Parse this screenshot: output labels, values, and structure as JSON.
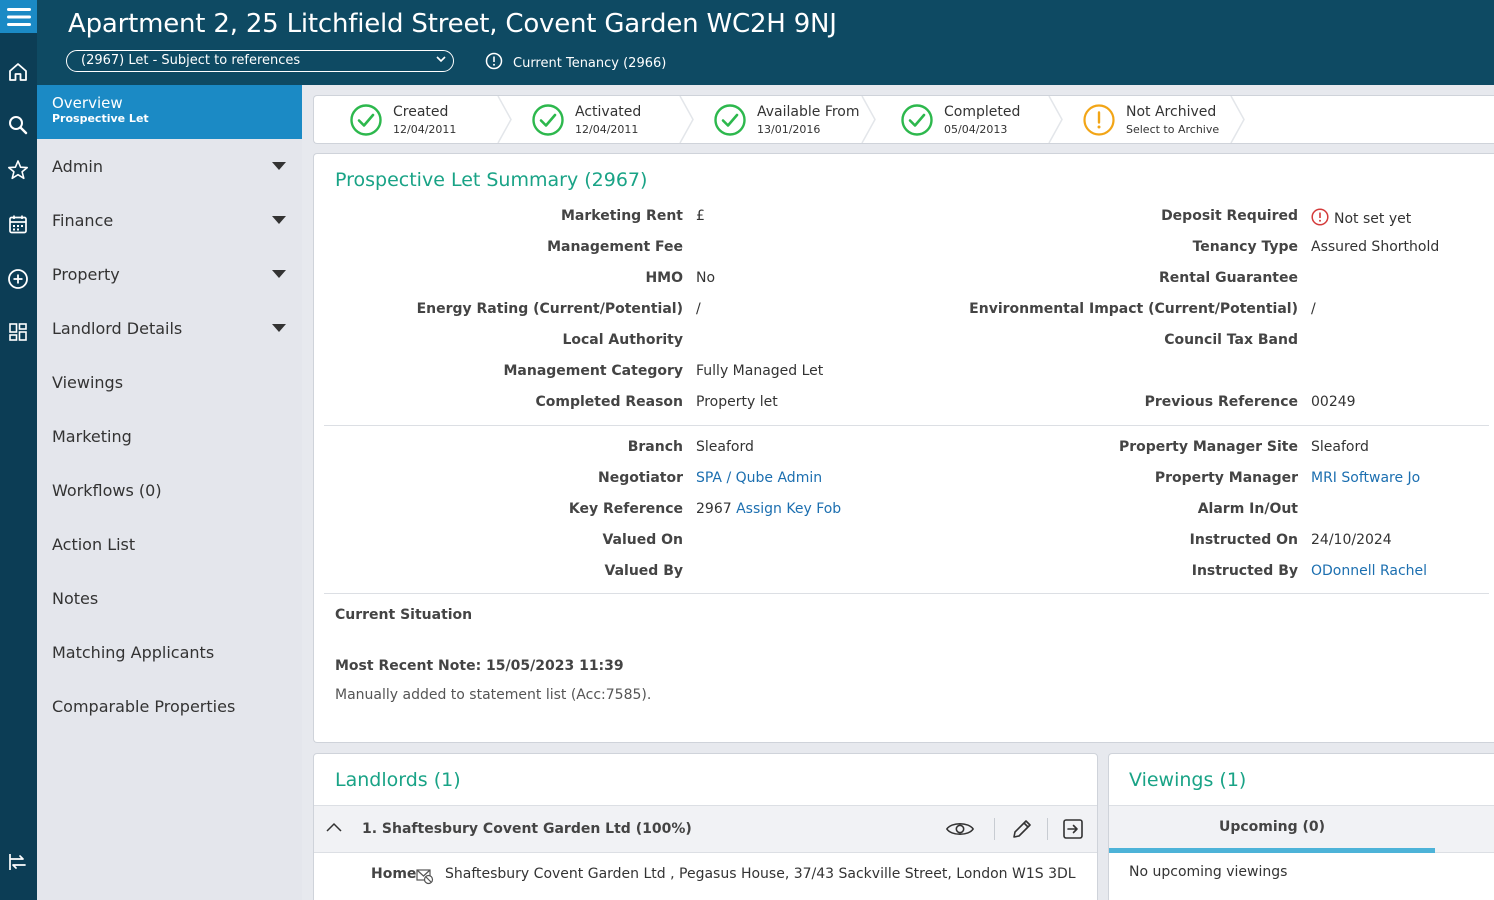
{
  "header": {
    "address": "Apartment 2, 25 Litchfield Street, Covent Garden WC2H 9NJ",
    "status_select": "(2967) Let - Subject to references",
    "current_tenancy": "Current Tenancy (2966)"
  },
  "rail": {
    "icons": [
      "menu-icon",
      "home-icon",
      "search-icon",
      "star-icon",
      "calendar-icon",
      "add-circle-icon",
      "dashboard-icon",
      "switch-icon"
    ]
  },
  "sidebar": {
    "active": {
      "title": "Overview",
      "subtitle": "Prospective Let"
    },
    "items": [
      {
        "label": "Admin",
        "expandable": true
      },
      {
        "label": "Finance",
        "expandable": true
      },
      {
        "label": "Property",
        "expandable": true
      },
      {
        "label": "Landlord Details",
        "expandable": true
      },
      {
        "label": "Viewings",
        "expandable": false
      },
      {
        "label": "Marketing",
        "expandable": false
      },
      {
        "label": "Workflows (0)",
        "expandable": false
      },
      {
        "label": "Action List",
        "expandable": false
      },
      {
        "label": "Notes",
        "expandable": false
      },
      {
        "label": "Matching Applicants",
        "expandable": false
      },
      {
        "label": "Comparable Properties",
        "expandable": false
      }
    ]
  },
  "progress": [
    {
      "label": "Created",
      "date": "12/04/2011",
      "status": "done"
    },
    {
      "label": "Activated",
      "date": "12/04/2011",
      "status": "done"
    },
    {
      "label": "Available From",
      "date": "13/01/2016",
      "status": "done"
    },
    {
      "label": "Completed",
      "date": "05/04/2013",
      "status": "done"
    },
    {
      "label": "Not Archived",
      "date": "Select to Archive",
      "status": "warning"
    }
  ],
  "summary": {
    "title": "Prospective Let Summary (2967)",
    "left": [
      {
        "label": "Marketing Rent",
        "value": "£"
      },
      {
        "label": "Management Fee",
        "value": ""
      },
      {
        "label": "HMO",
        "value": "No"
      },
      {
        "label": "Energy Rating (Current/Potential)",
        "value": "/"
      },
      {
        "label": "Local Authority",
        "value": ""
      },
      {
        "label": "Management Category",
        "value": "Fully Managed Let"
      },
      {
        "label": "Completed Reason",
        "value": "Property let"
      }
    ],
    "right": [
      {
        "label": "Deposit Required",
        "value": "Not set yet"
      },
      {
        "label": "Tenancy Type",
        "value": "Assured Shorthold"
      },
      {
        "label": "Rental Guarantee",
        "value": ""
      },
      {
        "label": "Environmental Impact (Current/Potential)",
        "value": "/"
      },
      {
        "label": "Council Tax Band",
        "value": ""
      },
      {
        "label": "",
        "value": ""
      },
      {
        "label": "Previous Reference",
        "value": "00249"
      }
    ],
    "left2": [
      {
        "label": "Branch",
        "value": "Sleaford"
      },
      {
        "label": "Negotiator",
        "value": "SPA / Qube Admin"
      },
      {
        "label": "Key Reference",
        "value": "2967",
        "link": "Assign Key Fob"
      },
      {
        "label": "Valued On",
        "value": ""
      },
      {
        "label": "Valued By",
        "value": ""
      }
    ],
    "right2": [
      {
        "label": "Property Manager Site",
        "value": "Sleaford"
      },
      {
        "label": "Property Manager",
        "value": "MRI Software Jo"
      },
      {
        "label": "Alarm In/Out",
        "value": ""
      },
      {
        "label": "Instructed On",
        "value": "24/10/2024"
      },
      {
        "label": "Instructed By",
        "value": "ODonnell Rachel"
      }
    ],
    "current_situation_label": "Current Situation",
    "recent_note_label": "Most Recent Note: 15/05/2023 11:39",
    "recent_note_text": "Manually added to statement list (Acc:7585)."
  },
  "landlords": {
    "title": "Landlords (1)",
    "row": "1. Shaftesbury Covent Garden Ltd (100%)",
    "address_label": "Home",
    "address": "Shaftesbury Covent Garden Ltd , Pegasus House, 37/43 Sackville Street, London W1S 3DL"
  },
  "viewings": {
    "title": "Viewings (1)",
    "tab": "Upcoming (0)",
    "empty": "No upcoming viewings"
  },
  "colors": {
    "header": "#0e4a63",
    "rail": "#0c3d55",
    "accent": "#1b8ac5",
    "title_green": "#19a386",
    "check_green": "#2db84d",
    "warn_orange": "#f2a516",
    "link": "#1c6fb0"
  }
}
